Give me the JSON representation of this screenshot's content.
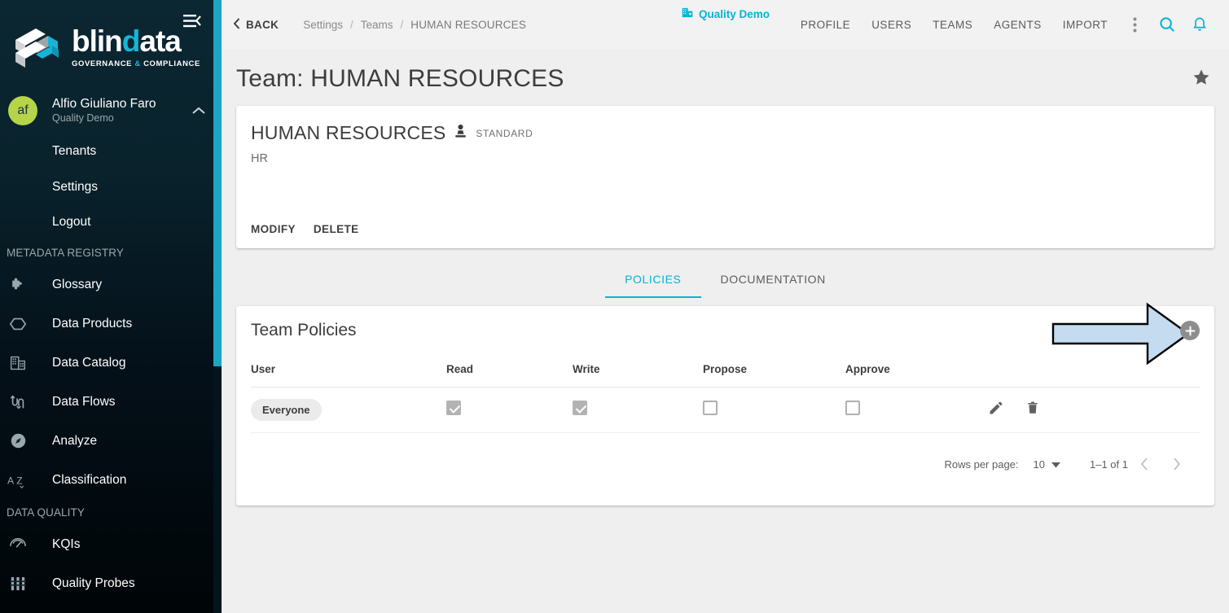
{
  "sidebar": {
    "collapse_icon": "menu-collapse-icon",
    "logo": {
      "word_1": "blin",
      "word_2": "d",
      "word_3": "ata",
      "tagline_1": "GOVERNANCE",
      "tagline_amp": "&",
      "tagline_2": "COMPLIANCE"
    },
    "user": {
      "initials": "af",
      "name": "Alfio Giuliano Faro",
      "tenant": "Quality Demo",
      "chevron": "chevron-up-icon"
    },
    "account_links": [
      {
        "label": "Tenants"
      },
      {
        "label": "Settings"
      },
      {
        "label": "Logout"
      }
    ],
    "sections": [
      {
        "title": "METADATA REGISTRY",
        "items": [
          {
            "label": "Glossary",
            "icon": "puzzle-piece-icon"
          },
          {
            "label": "Data Products",
            "icon": "hexagon-icon"
          },
          {
            "label": "Data Catalog",
            "icon": "building-icon"
          },
          {
            "label": "Data Flows",
            "icon": "data-flow-arrows-icon"
          },
          {
            "label": "Analyze",
            "icon": "compass-icon"
          },
          {
            "label": "Classification",
            "icon": "a-z-icon"
          }
        ]
      },
      {
        "title": "DATA QUALITY",
        "items": [
          {
            "label": "KQIs",
            "icon": "speedometer-icon"
          },
          {
            "label": "Quality Probes",
            "icon": "probes-icon"
          }
        ]
      }
    ]
  },
  "topbar": {
    "back_label": "BACK",
    "back_icon": "chevron-left-icon",
    "breadcrumb": [
      "Settings",
      "Teams",
      "HUMAN RESOURCES"
    ],
    "breadcrumb_separator": "/",
    "tenant_badge": {
      "label": "Quality Demo",
      "icon": "building-icon",
      "color": "#00b6d4"
    },
    "nav": [
      {
        "label": "PROFILE"
      },
      {
        "label": "USERS"
      },
      {
        "label": "TEAMS"
      },
      {
        "label": "AGENTS"
      },
      {
        "label": "IMPORT"
      }
    ],
    "icons": [
      {
        "name": "more-vertical-icon",
        "color": "#8a8a8a"
      },
      {
        "name": "search-icon",
        "color": "#00b6d4"
      },
      {
        "name": "notifications-bell-icon",
        "color": "#00b6d4"
      }
    ]
  },
  "page": {
    "title": "Team: HUMAN RESOURCES",
    "favorite_icon": "star-filled-icon"
  },
  "entity_card": {
    "name": "HUMAN RESOURCES",
    "role_icon": "person-stamp-icon",
    "kind": "STANDARD",
    "description": "HR",
    "actions": [
      {
        "label": "MODIFY"
      },
      {
        "label": "DELETE"
      }
    ]
  },
  "tabs": [
    {
      "label": "POLICIES",
      "active": true
    },
    {
      "label": "DOCUMENTATION",
      "active": false
    }
  ],
  "policies_card": {
    "title": "Team Policies",
    "add_button": {
      "icon": "plus-circle-icon",
      "label": "+"
    },
    "columns": [
      "User",
      "Read",
      "Write",
      "Propose",
      "Approve",
      ""
    ],
    "rows": [
      {
        "user": "Everyone",
        "read": true,
        "write": true,
        "propose": false,
        "approve": false,
        "edit_icon": "pencil-edit-icon",
        "delete_icon": "trash-delete-icon"
      }
    ],
    "paginator": {
      "rows_per_page_label": "Rows per page:",
      "rows_per_page_value": "10",
      "dropdown_icon": "caret-down-icon",
      "range_label": "1–1 of 1",
      "prev_icon": "chevron-left-icon",
      "next_icon": "chevron-right-icon"
    }
  },
  "annotation": {
    "arrow": {
      "name": "pointer-arrow-annotation",
      "fill": "#c4dbf0",
      "stroke": "#000000"
    }
  }
}
